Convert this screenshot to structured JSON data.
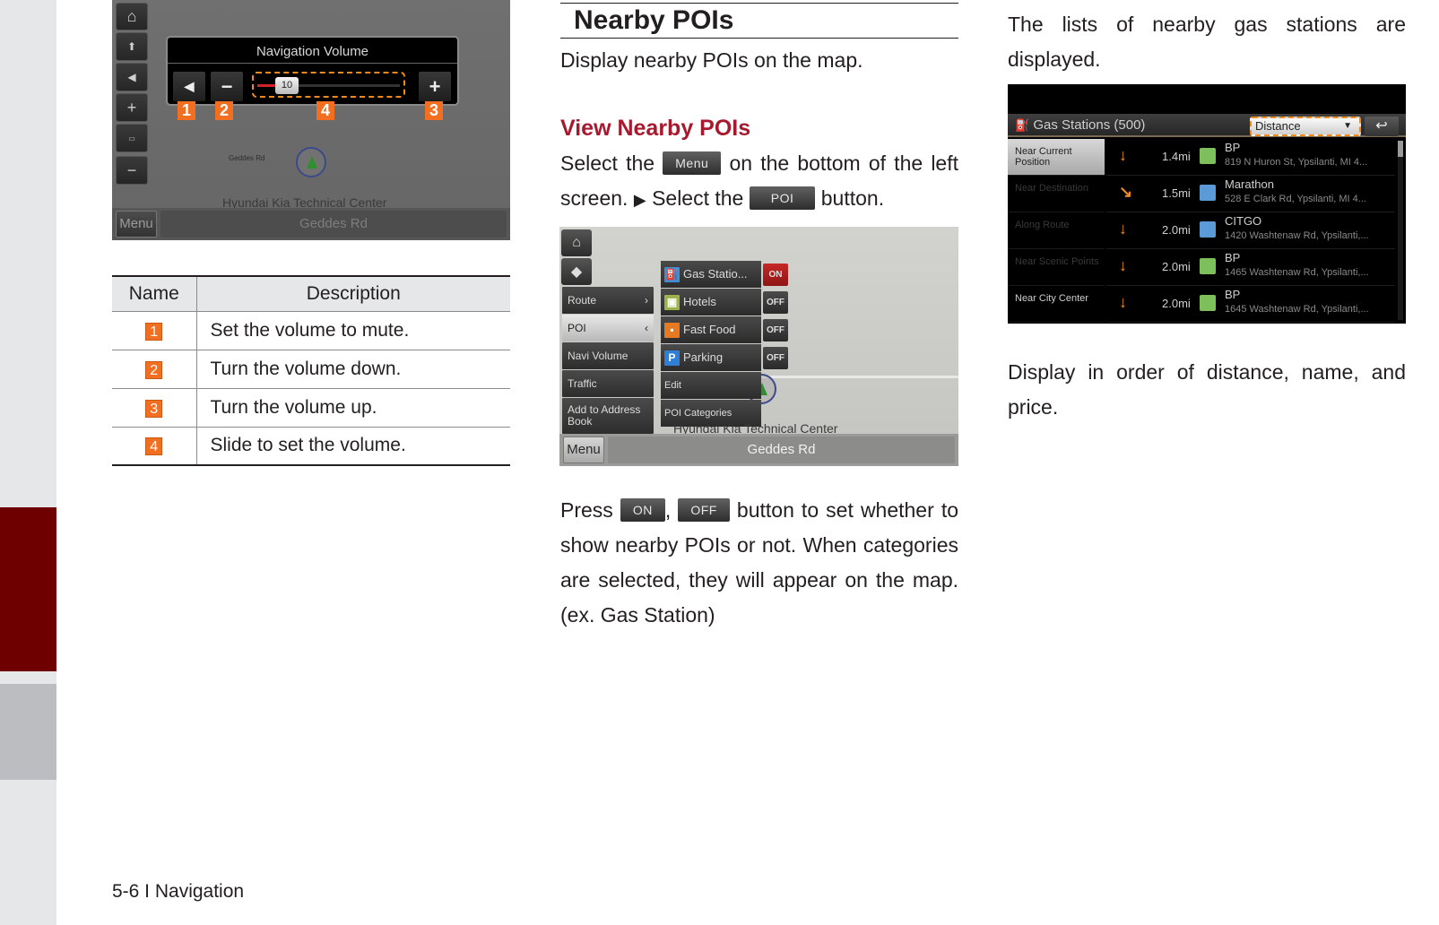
{
  "footer": {
    "page_label": "5-6 I Navigation"
  },
  "volume_screen": {
    "title": "Navigation Volume",
    "mute_icon": "speaker-icon",
    "minus_label": "−",
    "plus_label": "+",
    "volume_value": "10",
    "volume_fraction": 0.15,
    "callouts": [
      "1",
      "2",
      "4",
      "3"
    ],
    "map_label_road": "Geddes Rd",
    "map_label_center": "Hyundai Kia Technical Center",
    "menu_label": "Menu",
    "road_label": "Geddes Rd",
    "rail_buttons": [
      "home-icon",
      "compass-icon",
      "speaker-icon",
      "zoom-in-icon",
      "scale-icon",
      "zoom-out-icon"
    ]
  },
  "desc_table": {
    "headers": [
      "Name",
      "Description"
    ],
    "rows": [
      {
        "num": "1",
        "desc": "Set the volume to mute."
      },
      {
        "num": "2",
        "desc": "Turn the volume down."
      },
      {
        "num": "3",
        "desc": "Turn the volume up."
      },
      {
        "num": "4",
        "desc": "Slide to set the volume."
      }
    ]
  },
  "section": {
    "title": "Nearby POIs",
    "intro": "Display nearby POIs on the map.",
    "subtitle": "View Nearby POIs",
    "instr_part1": "Select the",
    "menu_chip": "Menu",
    "instr_part2": "on the bottom of the left screen.",
    "arrow": "▶",
    "instr_part3": "Select the",
    "poi_chip": "POI",
    "instr_part4": "button.",
    "onoff_part1": "Press",
    "on_chip": "ON",
    "comma": ",",
    "off_chip": "OFF",
    "onoff_part2": "button to set whether to show nearby POIs or not. When categories are selected, they will appear on the map. (ex. Gas Station)"
  },
  "poi_screen": {
    "main_menu": [
      {
        "label": "Route",
        "chev": "›"
      },
      {
        "label": "POI",
        "chev": "‹",
        "selected": true
      },
      {
        "label": "Navi Volume"
      },
      {
        "label": "Traffic"
      },
      {
        "label": "Add to Address Book"
      }
    ],
    "sub_menu": [
      {
        "label": "Gas Statio...",
        "icon": "gas-station-icon",
        "toggle": "ON"
      },
      {
        "label": "Hotels",
        "icon": "hotel-icon",
        "toggle": "OFF"
      },
      {
        "label": "Fast Food",
        "icon": "fast-food-icon",
        "toggle": "OFF"
      },
      {
        "label": "Parking",
        "icon": "parking-icon",
        "toggle": "OFF"
      },
      {
        "label": "Edit"
      },
      {
        "label": "POI Categories"
      }
    ],
    "map_label_center": "Hyundai Kia Technical Center",
    "menu_label": "Menu",
    "road_label": "Geddes Rd",
    "parking_glyph": "P"
  },
  "gas_section": {
    "intro": "The lists of nearby gas stations are displayed.",
    "outro": "Display in order of distance, name, and price."
  },
  "gas_screen": {
    "title": "Gas Stations (500)",
    "sort_value": "Distance",
    "back_icon": "back-arrow-icon",
    "filters": [
      {
        "label": "Near Current Position",
        "state": "selected"
      },
      {
        "label": "Near Destination",
        "state": "disabled"
      },
      {
        "label": "Along Route",
        "state": "disabled"
      },
      {
        "label": "Near Scenic Points",
        "state": "disabled"
      },
      {
        "label": "Near City Center",
        "state": "active"
      }
    ],
    "stations": [
      {
        "direction": "south",
        "dist": "1.4mi",
        "brand": "BP",
        "address": "819 N Huron St, Ypsilanti, MI 4..."
      },
      {
        "direction": "southeast",
        "dist": "1.5mi",
        "brand": "Marathon",
        "address": "528 E Clark Rd, Ypsilanti, MI 4..."
      },
      {
        "direction": "south",
        "dist": "2.0mi",
        "brand": "CITGO",
        "address": "1420 Washtenaw Rd, Ypsilanti,..."
      },
      {
        "direction": "south",
        "dist": "2.0mi",
        "brand": "BP",
        "address": "1465 Washtenaw Rd, Ypsilanti,..."
      },
      {
        "direction": "south",
        "dist": "2.0mi",
        "brand": "BP",
        "address": "1645 Washtenaw Rd, Ypsilanti,..."
      }
    ]
  },
  "colors": {
    "accent_red": "#a6192e",
    "chapter_tab": "#6e0000",
    "callout_orange": "#f26f21",
    "on_toggle": "#c62828"
  }
}
